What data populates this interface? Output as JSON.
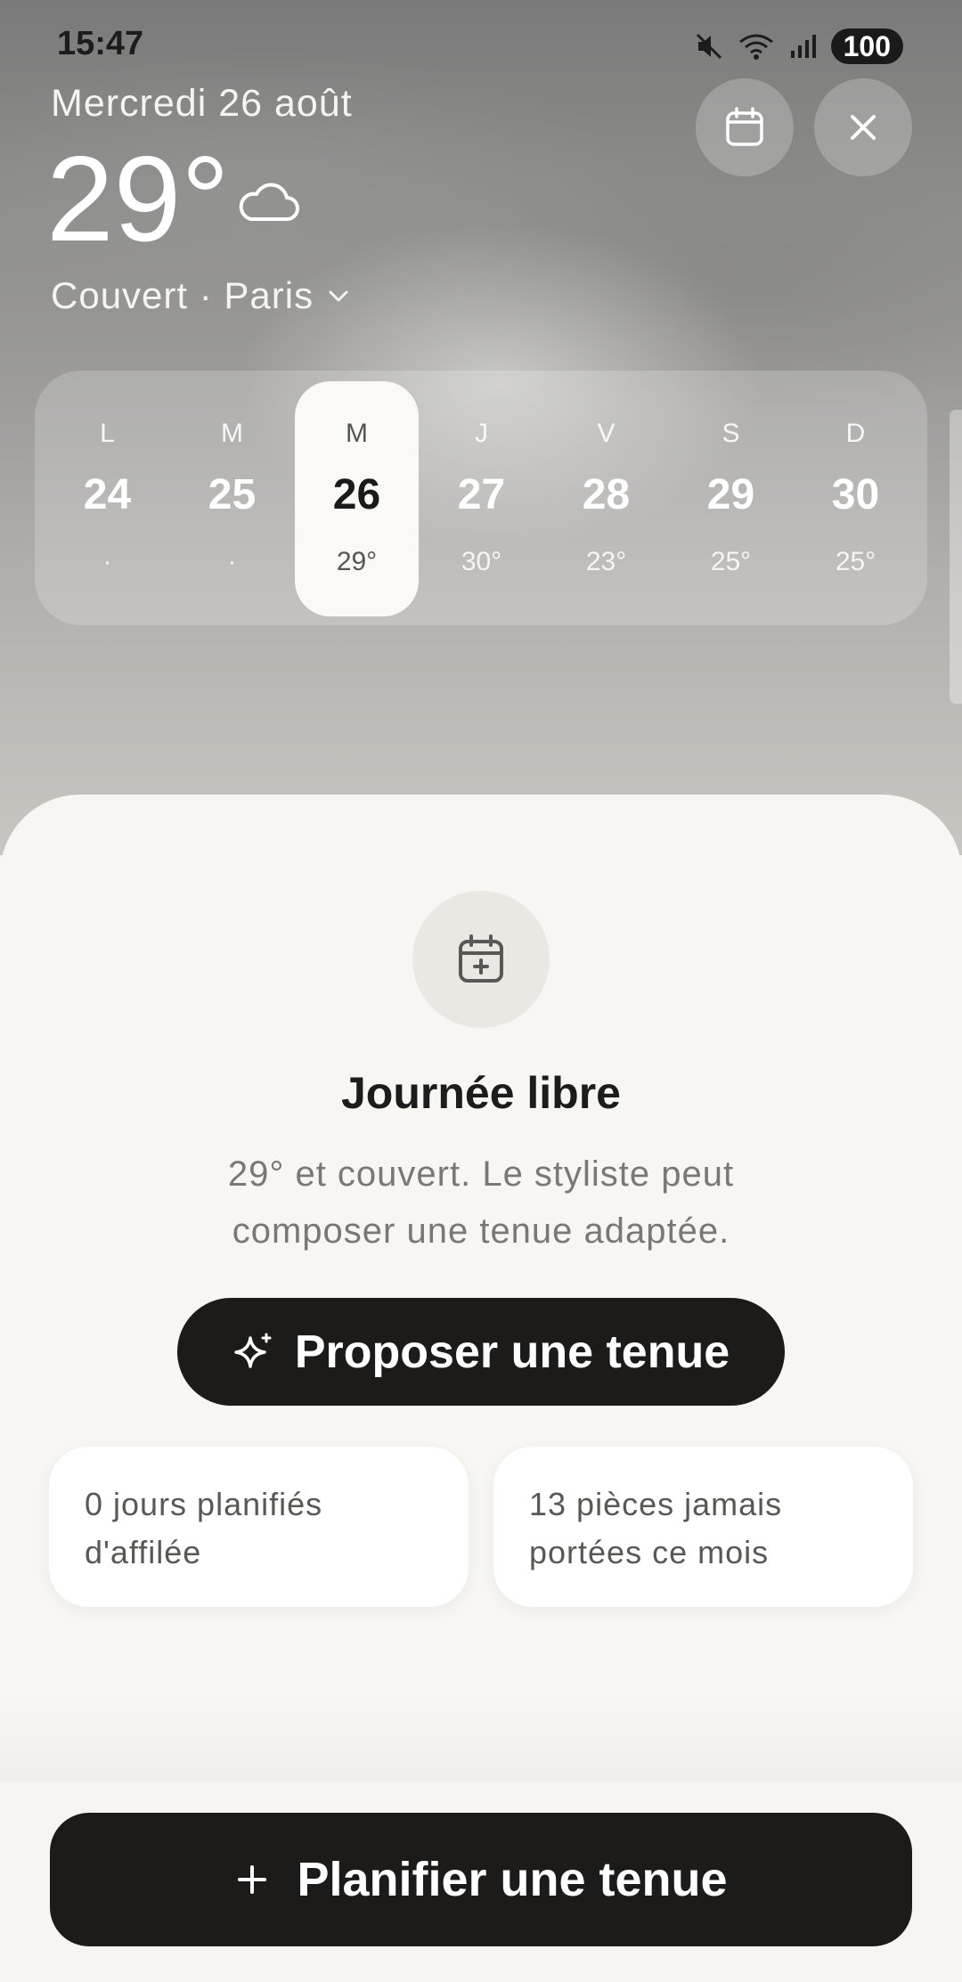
{
  "status_bar": {
    "time": "15:47",
    "battery": "100",
    "icons": [
      "mute-icon",
      "wifi-icon",
      "signal-icon"
    ]
  },
  "header": {
    "date": "Mercredi 26 août",
    "temperature": "29°",
    "weather_icon": "cloud-icon",
    "condition_location": "Couvert · Paris",
    "calendar_button_icon": "calendar-icon",
    "close_button_icon": "close-icon"
  },
  "week": {
    "days": [
      {
        "dow": "L",
        "num": "24",
        "temp": "·",
        "selected": false
      },
      {
        "dow": "M",
        "num": "25",
        "temp": "·",
        "selected": false
      },
      {
        "dow": "M",
        "num": "26",
        "temp": "29°",
        "selected": true
      },
      {
        "dow": "J",
        "num": "27",
        "temp": "30°",
        "selected": false
      },
      {
        "dow": "V",
        "num": "28",
        "temp": "23°",
        "selected": false
      },
      {
        "dow": "S",
        "num": "29",
        "temp": "25°",
        "selected": false
      },
      {
        "dow": "D",
        "num": "30",
        "temp": "25°",
        "selected": false
      }
    ]
  },
  "sheet": {
    "icon": "calendar-plus-icon",
    "title": "Journée libre",
    "description": "29° et couvert. Le styliste peut composer une tenue adaptée.",
    "propose_button": "Proposer une tenue",
    "propose_icon": "sparkle-icon",
    "stats": [
      "0 jours planifiés d'affilée",
      "13 pièces jamais portées ce mois"
    ]
  },
  "bottom": {
    "plan_button": "Planifier une tenue",
    "plan_icon": "plus-icon"
  },
  "colors": {
    "dark_button": "#1c1b1a",
    "sheet_background": "#f7f6f3",
    "selected_day": "#faf9f6"
  }
}
